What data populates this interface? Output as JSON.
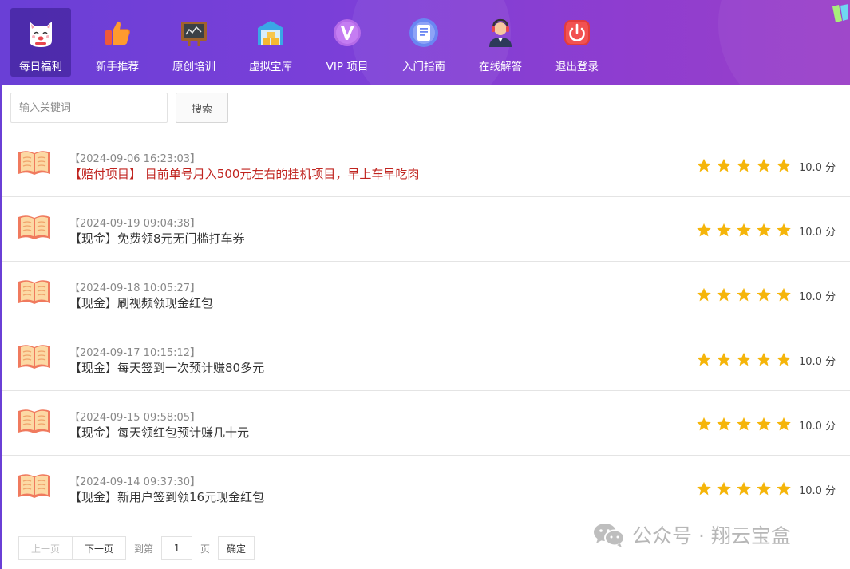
{
  "nav": {
    "items": [
      {
        "label": "每日福利",
        "icon": "lucky-cat-icon",
        "active": true
      },
      {
        "label": "新手推荐",
        "icon": "thumbs-up-icon",
        "active": false
      },
      {
        "label": "原创培训",
        "icon": "chalkboard-icon",
        "active": false
      },
      {
        "label": "虚拟宝库",
        "icon": "treasure-warehouse-icon",
        "active": false
      },
      {
        "label": "VIP 项目",
        "icon": "vip-badge-icon",
        "active": false
      },
      {
        "label": "入门指南",
        "icon": "guide-document-icon",
        "active": false
      },
      {
        "label": "在线解答",
        "icon": "support-agent-icon",
        "active": false
      },
      {
        "label": "退出登录",
        "icon": "power-off-icon",
        "active": false
      }
    ]
  },
  "search": {
    "placeholder": "输入关键词",
    "button_label": "搜索"
  },
  "list": {
    "items": [
      {
        "date": "【2024-09-06 16:23:03】",
        "title": "【赔付项目】 目前单号月入500元左右的挂机项目，早上车早吃肉",
        "highlight": true,
        "rating": 5,
        "score": "10.0 分"
      },
      {
        "date": "【2024-09-19 09:04:38】",
        "title": "【现金】免费领8元无门槛打车券",
        "highlight": false,
        "rating": 5,
        "score": "10.0 分"
      },
      {
        "date": "【2024-09-18 10:05:27】",
        "title": "【现金】刷视频领现金红包",
        "highlight": false,
        "rating": 5,
        "score": "10.0 分"
      },
      {
        "date": "【2024-09-17 10:15:12】",
        "title": "【现金】每天签到一次预计赚80多元",
        "highlight": false,
        "rating": 5,
        "score": "10.0 分"
      },
      {
        "date": "【2024-09-15 09:58:05】",
        "title": "【现金】每天领红包预计赚几十元",
        "highlight": false,
        "rating": 5,
        "score": "10.0 分"
      },
      {
        "date": "【2024-09-14 09:37:30】",
        "title": "【现金】新用户签到领16元现金红包",
        "highlight": false,
        "rating": 5,
        "score": "10.0 分"
      }
    ]
  },
  "pagination": {
    "prev_label": "上一页",
    "next_label": "下一页",
    "goto_label": "到第",
    "page_value": "1",
    "page_unit": "页",
    "confirm_label": "确定"
  },
  "watermark": {
    "text": "公众号 · 翔云宝盒",
    "icon": "wechat-icon"
  },
  "colors": {
    "nav_start": "#6a3fd6",
    "nav_end": "#9a3fc8",
    "star": "#f5b50a",
    "highlight_title": "#c0241f"
  }
}
